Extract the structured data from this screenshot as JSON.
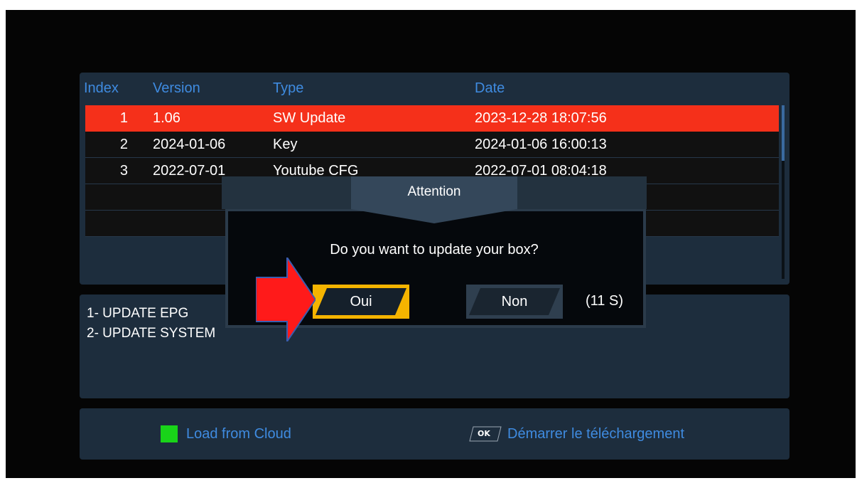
{
  "list": {
    "headers": {
      "index": "Index",
      "version": "Version",
      "type": "Type",
      "date": "Date"
    },
    "rows": [
      {
        "index": "1",
        "version": "1.06",
        "type": "SW Update",
        "date": "2023-12-28 18:07:56"
      },
      {
        "index": "2",
        "version": "2024-01-06",
        "type": "Key",
        "date": "2024-01-06 16:00:13"
      },
      {
        "index": "3",
        "version": "2022-07-01",
        "type": "Youtube CFG",
        "date": "2022-07-01 08:04:18"
      },
      {
        "index": "",
        "version": "",
        "type": "",
        "date": ""
      },
      {
        "index": "",
        "version": "",
        "type": "",
        "date": ""
      }
    ],
    "selected_index": 0
  },
  "info": {
    "lines": [
      "1- UPDATE EPG",
      "2- UPDATE SYSTEM"
    ]
  },
  "footer": {
    "green_label": "Load from Cloud",
    "ok_key": "OK",
    "ok_label": "Démarrer le téléchargement"
  },
  "dialog": {
    "title": "Attention",
    "message": "Do you want to update your box?",
    "yes_label": "Oui",
    "no_label": "Non",
    "countdown": "(11 S)"
  },
  "colors": {
    "selected_row": "#f5301a",
    "header_text": "#3f8be0",
    "focused_button": "#f5b400",
    "green_key": "#19d419",
    "arrow": "#ff1a1a"
  },
  "icons": {
    "pointer_arrow": "red-arrow-icon",
    "green_key": "green-key-icon",
    "ok_key": "ok-key-icon"
  }
}
